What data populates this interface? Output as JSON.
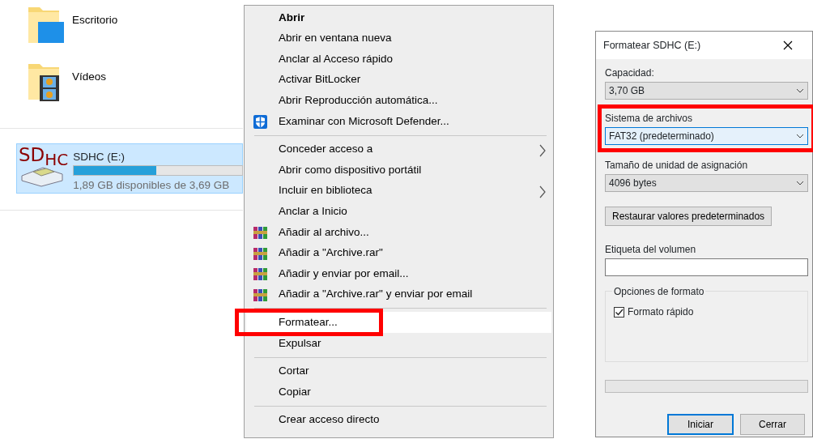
{
  "explorer": {
    "folders": [
      {
        "name": "Escritorio",
        "kind": "desktop"
      },
      {
        "name": "Vídeos",
        "kind": "videos"
      }
    ],
    "drive": {
      "name": "SDHC (E:)",
      "logo": "SD",
      "logo_sub": "HC",
      "selected": true,
      "level": 0.49,
      "free_text": "1,89 GB disponibles de 3,69 GB"
    }
  },
  "context_menu": {
    "items": [
      {
        "kind": "item",
        "label": "Abrir",
        "default": true,
        "submenu": false,
        "selected": false,
        "highlighted": false
      },
      {
        "kind": "item",
        "label": "Abrir en ventana nueva",
        "default": false,
        "submenu": false,
        "selected": false,
        "highlighted": false
      },
      {
        "kind": "item",
        "label": "Anclar al Acceso rápido",
        "default": false,
        "submenu": false,
        "selected": false,
        "highlighted": false
      },
      {
        "kind": "item",
        "label": "Activar BitLocker",
        "default": false,
        "submenu": false,
        "selected": false,
        "highlighted": false
      },
      {
        "kind": "item",
        "label": "Abrir Reproducción automática...",
        "default": false,
        "submenu": false,
        "selected": false,
        "highlighted": false
      },
      {
        "kind": "shield_item",
        "label": "Examinar con Microsoft Defender...",
        "default": false,
        "submenu": false,
        "selected": false,
        "highlighted": false
      },
      {
        "kind": "separator"
      },
      {
        "kind": "item",
        "label": "Conceder acceso a",
        "default": false,
        "submenu": true,
        "selected": false,
        "highlighted": false
      },
      {
        "kind": "item",
        "label": "Abrir como dispositivo portátil",
        "default": false,
        "submenu": false,
        "selected": false,
        "highlighted": false
      },
      {
        "kind": "item",
        "label": "Incluir en biblioteca",
        "default": false,
        "submenu": true,
        "selected": false,
        "highlighted": false
      },
      {
        "kind": "item",
        "label": "Anclar a Inicio",
        "default": false,
        "submenu": false,
        "selected": false,
        "highlighted": false
      },
      {
        "kind": "archive_item",
        "label": "Añadir al archivo...",
        "default": false,
        "submenu": false,
        "selected": false,
        "highlighted": false
      },
      {
        "kind": "archive_item",
        "label": "Añadir a \"Archive.rar\"",
        "default": false,
        "submenu": false,
        "selected": false,
        "highlighted": false
      },
      {
        "kind": "archive_item",
        "label": "Añadir y enviar por email...",
        "default": false,
        "submenu": false,
        "selected": false,
        "highlighted": false
      },
      {
        "kind": "archive_item",
        "label": "Añadir a \"Archive.rar\" y enviar por email",
        "default": false,
        "submenu": false,
        "selected": false,
        "highlighted": false
      },
      {
        "kind": "separator"
      },
      {
        "kind": "item",
        "label": "Formatear...",
        "default": false,
        "submenu": false,
        "selected": true,
        "highlighted": true
      },
      {
        "kind": "item",
        "label": "Expulsar",
        "default": false,
        "submenu": false,
        "selected": false,
        "highlighted": false
      },
      {
        "kind": "separator"
      },
      {
        "kind": "item",
        "label": "Cortar",
        "default": false,
        "submenu": false,
        "selected": false,
        "highlighted": false
      },
      {
        "kind": "item",
        "label": "Copiar",
        "default": false,
        "submenu": false,
        "selected": false,
        "highlighted": false
      },
      {
        "kind": "separator"
      },
      {
        "kind": "item",
        "label": "Crear acceso directo",
        "default": false,
        "submenu": false,
        "selected": false,
        "highlighted": false
      }
    ]
  },
  "dialog": {
    "title": "Formatear SDHC (E:)",
    "fields": [
      {
        "label": "Capacidad:",
        "value": "3,70 GB",
        "focused": false,
        "highlighted": false
      },
      {
        "label": "Sistema de archivos",
        "value": "FAT32 (predeterminado)",
        "focused": true,
        "highlighted": true
      },
      {
        "label": "Tamaño de unidad de asignación",
        "value": "4096 bytes",
        "focused": false,
        "highlighted": false
      }
    ],
    "restore_button": "Restaurar valores predeterminados",
    "volume_label": {
      "label": "Etiqueta del volumen"
    },
    "options": {
      "title": "Opciones de formato",
      "checkbox": {
        "label": "Formato rápido",
        "checked": true
      }
    },
    "progress": {
      "level": 0
    },
    "buttons": [
      {
        "label": "Iniciar",
        "default": true
      },
      {
        "label": "Cerrar",
        "default": false
      }
    ]
  }
}
